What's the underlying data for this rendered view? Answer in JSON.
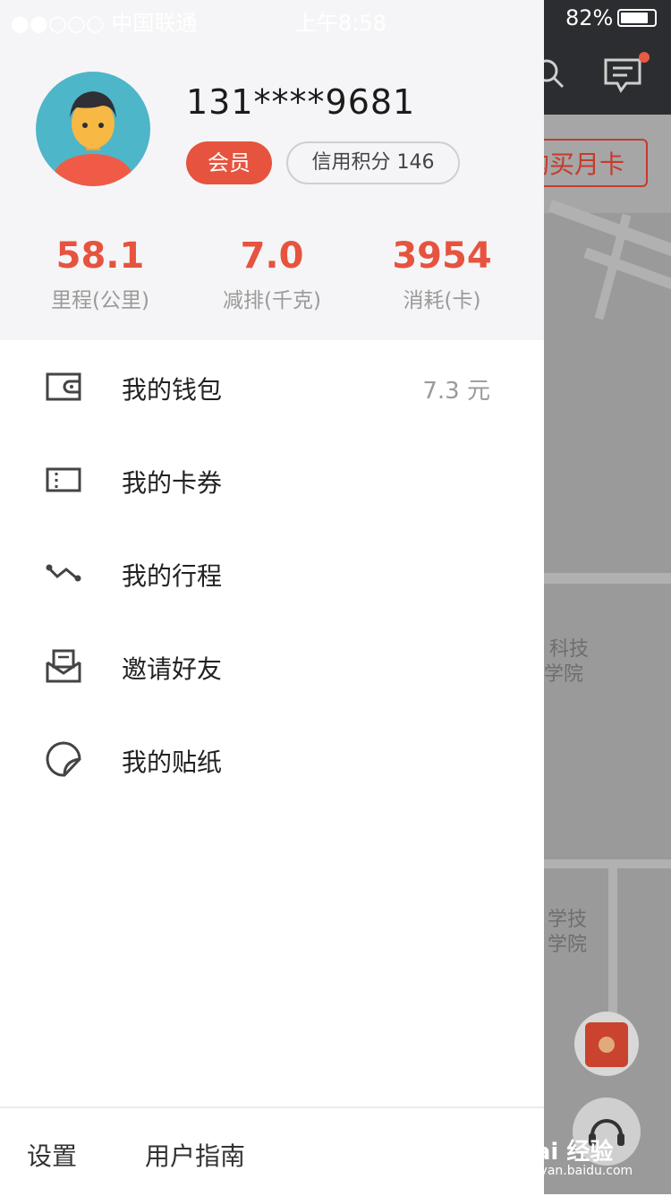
{
  "status_bar": {
    "carrier": "●●○○○ 中国联通",
    "time": "上午8:58",
    "battery": "82%"
  },
  "map": {
    "buy_button": "购买月卡",
    "labels": [
      "科技",
      "学院",
      "学技",
      "学院"
    ],
    "icons": [
      "search-icon",
      "message-icon",
      "red-packet-icon",
      "customer-service-icon"
    ]
  },
  "profile": {
    "phone": "131****9681",
    "member_badge": "会员",
    "credit_badge": "信用积分 146",
    "stats": [
      {
        "value": "58.1",
        "label": "里程(公里)"
      },
      {
        "value": "7.0",
        "label": "减排(千克)"
      },
      {
        "value": "3954",
        "label": "消耗(卡)"
      }
    ]
  },
  "menu": {
    "items": [
      {
        "label": "我的钱包",
        "value": "7.3  元",
        "icon": "wallet-icon"
      },
      {
        "label": "我的卡券",
        "value": "",
        "icon": "ticket-icon"
      },
      {
        "label": "我的行程",
        "value": "",
        "icon": "route-icon"
      },
      {
        "label": "邀请好友",
        "value": "",
        "icon": "invite-envelope-icon"
      },
      {
        "label": "我的贴纸",
        "value": "",
        "icon": "sticker-icon"
      }
    ]
  },
  "footer": {
    "settings": "设置",
    "guide": "用户指南"
  },
  "watermark": {
    "brand": "Bai 经验",
    "site": "jingyan.baidu.com"
  },
  "colors": {
    "accent": "#e6533f",
    "profile_bg": "#f5f5f7",
    "map_top": "#2c2d30"
  }
}
